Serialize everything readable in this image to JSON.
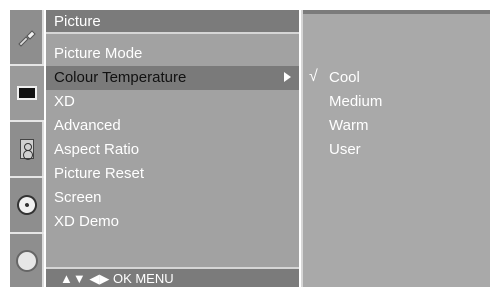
{
  "menu": {
    "title": "Picture",
    "items": [
      {
        "label": "Picture Mode",
        "selected": false,
        "has_submenu": false
      },
      {
        "label": "Colour Temperature",
        "selected": true,
        "has_submenu": true
      },
      {
        "label": "XD",
        "selected": false,
        "has_submenu": false
      },
      {
        "label": "Advanced",
        "selected": false,
        "has_submenu": false
      },
      {
        "label": "Aspect Ratio",
        "selected": false,
        "has_submenu": false
      },
      {
        "label": "Picture Reset",
        "selected": false,
        "has_submenu": false
      },
      {
        "label": "Screen",
        "selected": false,
        "has_submenu": false
      },
      {
        "label": "XD Demo",
        "selected": false,
        "has_submenu": false
      }
    ],
    "footer": "▲▼  ◀▶  OK  MENU"
  },
  "submenu": {
    "items": [
      {
        "label": "Cool",
        "checked": true,
        "check_glyph": "√"
      },
      {
        "label": "Medium",
        "checked": false
      },
      {
        "label": "Warm",
        "checked": false
      },
      {
        "label": "User",
        "checked": false
      }
    ]
  },
  "icons": [
    "settings-icon",
    "tv-screen-icon",
    "speaker-icon",
    "disc-icon",
    "gear-icon"
  ],
  "colors": {
    "menu_bg": "#a2a2a2",
    "header_bg": "#7b7b7b",
    "selected_bg": "#7a7a7a",
    "submenu_bg": "#a9a9a9",
    "text_light": "#ffffff",
    "text_selected": "#111111"
  }
}
